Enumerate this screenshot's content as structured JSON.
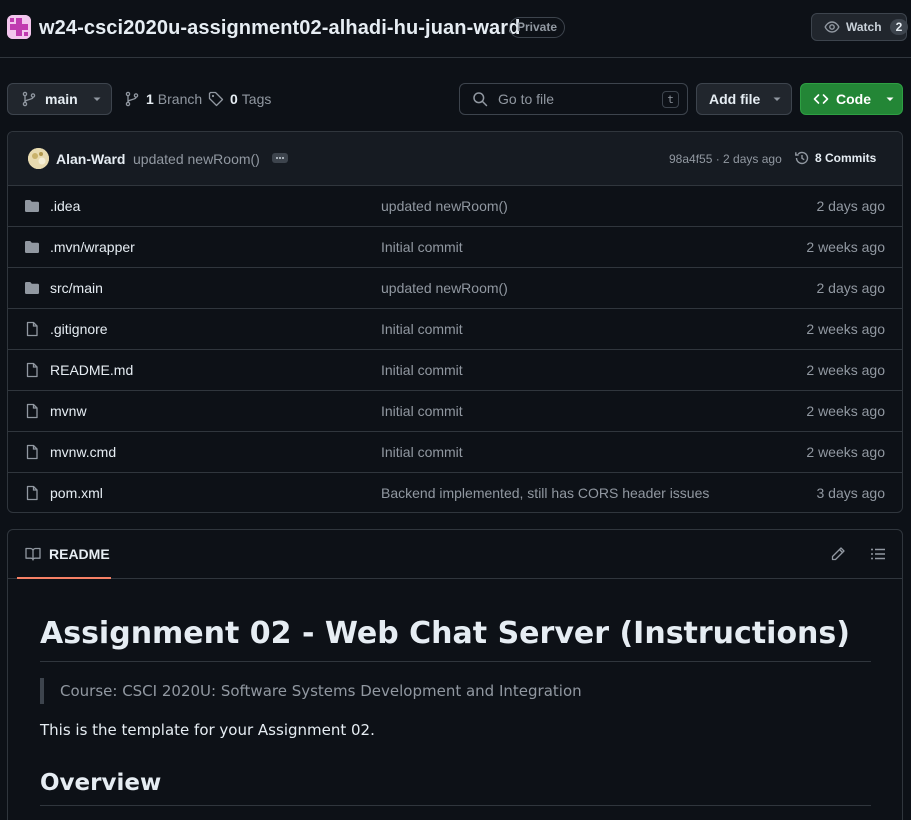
{
  "header": {
    "repo_name": "w24-csci2020u-assignment02-alhadi-hu-juan-ward",
    "visibility": "Private",
    "watch_label": "Watch",
    "watch_count": "2"
  },
  "toolbar": {
    "branch": "main",
    "branch_count": "1",
    "branch_label": "Branch",
    "tag_count": "0",
    "tag_label": "Tags",
    "search_placeholder": "Go to file",
    "search_shortcut": "t",
    "add_file_label": "Add file",
    "code_label": "Code"
  },
  "latest_commit": {
    "author": "Alan-Ward",
    "message": "updated newRoom()",
    "meta": "98a4f55 · 2 days ago",
    "commits_label": "8 Commits"
  },
  "files": [
    {
      "name": ".idea",
      "type": "folder",
      "commit": "updated newRoom()",
      "time": "2 days ago"
    },
    {
      "name": ".mvn/wrapper",
      "type": "folder",
      "commit": "Initial commit",
      "time": "2 weeks ago"
    },
    {
      "name": "src/main",
      "type": "folder",
      "commit": "updated newRoom()",
      "time": "2 days ago"
    },
    {
      "name": ".gitignore",
      "type": "file",
      "commit": "Initial commit",
      "time": "2 weeks ago"
    },
    {
      "name": "README.md",
      "type": "file",
      "commit": "Initial commit",
      "time": "2 weeks ago"
    },
    {
      "name": "mvnw",
      "type": "file",
      "commit": "Initial commit",
      "time": "2 weeks ago"
    },
    {
      "name": "mvnw.cmd",
      "type": "file",
      "commit": "Initial commit",
      "time": "2 weeks ago"
    },
    {
      "name": "pom.xml",
      "type": "file",
      "commit": "Backend implemented, still has CORS header issues",
      "time": "3 days ago"
    }
  ],
  "readme": {
    "tab_label": "README",
    "h1": "Assignment 02 - Web Chat Server (Instructions)",
    "quote": "Course: CSCI 2020U: Software Systems Development and Integration",
    "paragraph": "This is the template for your Assignment 02.",
    "h2": "Overview"
  },
  "colors": {
    "background": "#0d1117",
    "border": "#30363d",
    "code_button": "#238636",
    "tab_underline": "#f78166"
  }
}
